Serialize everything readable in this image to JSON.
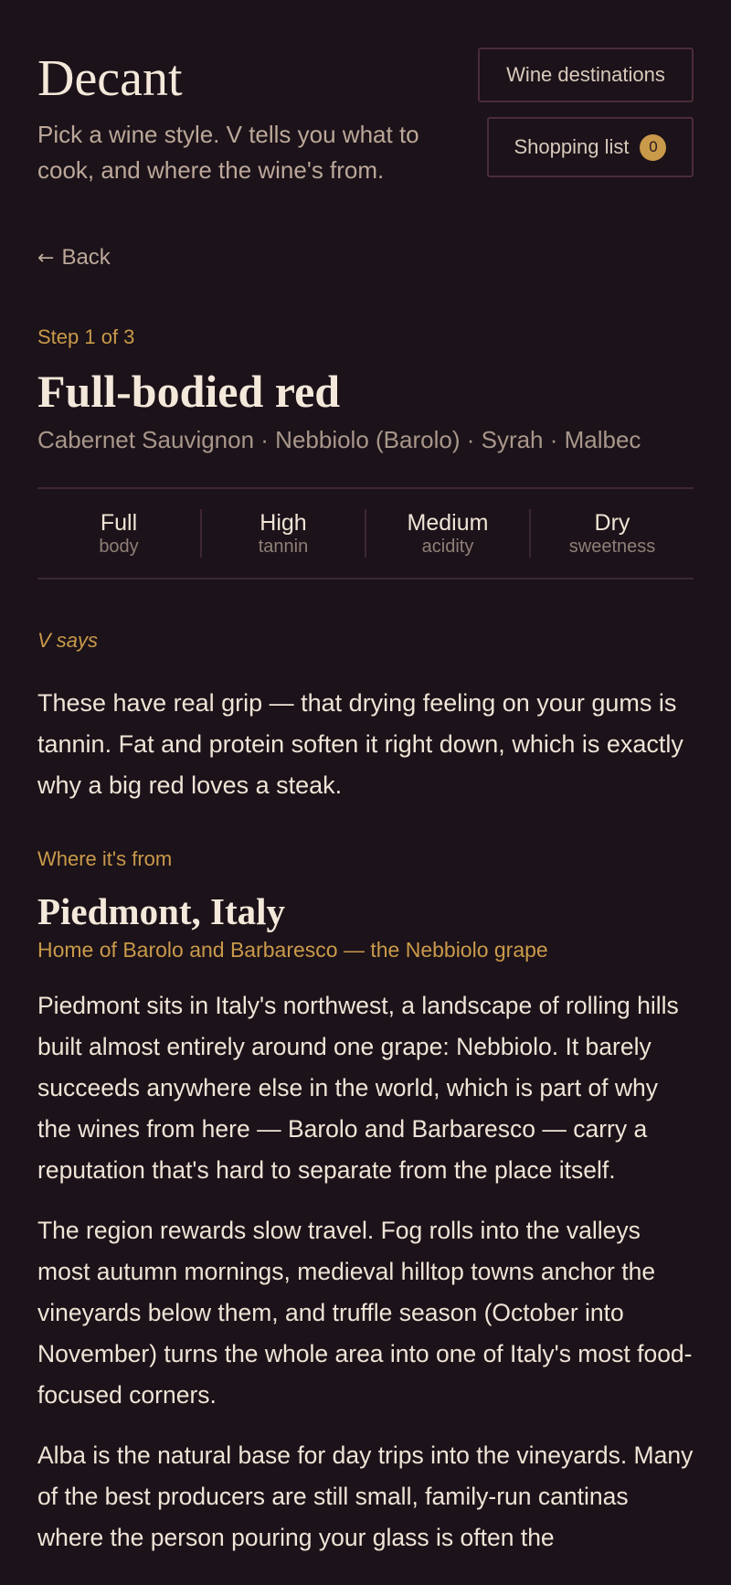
{
  "header": {
    "title": "Decant",
    "tagline": "Pick a wine style. V tells you what to cook, and where the wine's from.",
    "destinations_label": "Wine destinations",
    "shopping_label": "Shopping list",
    "shopping_count": "0"
  },
  "nav": {
    "back_label": "Back",
    "back_icon": "left-arrow-icon"
  },
  "step": {
    "label": "Step 1 of 3",
    "title": "Full-bodied red",
    "grapes": "Cabernet Sauvignon · Nebbiolo (Barolo) · Syrah · Malbec"
  },
  "attributes": [
    {
      "value": "Full",
      "label": "body"
    },
    {
      "value": "High",
      "label": "tannin"
    },
    {
      "value": "Medium",
      "label": "acidity"
    },
    {
      "value": "Dry",
      "label": "sweetness"
    }
  ],
  "v_says": {
    "label": "V says",
    "text": "These have real grip — that drying feeling on your gums is tannin. Fat and protein soften it right down, which is exactly why a big red loves a steak."
  },
  "origin": {
    "label": "Where it's from",
    "region": "Piedmont, Italy",
    "subtitle": "Home of Barolo and Barbaresco — the Nebbiolo grape",
    "paragraphs": [
      "Piedmont sits in Italy's northwest, a landscape of rolling hills built almost entirely around one grape: Nebbiolo. It barely succeeds anywhere else in the world, which is part of why the wines from here — Barolo and Barbaresco — carry a reputation that's hard to separate from the place itself.",
      "The region rewards slow travel. Fog rolls into the valleys most autumn mornings, medieval hilltop towns anchor the vineyards below them, and truffle season (October into November) turns the whole area into one of Italy's most food-focused corners.",
      "Alba is the natural base for day trips into the vineyards. Many of the best producers are still small, family-run cantinas where the person pouring your glass is often the"
    ]
  },
  "colors": {
    "background": "#1c1219",
    "accent": "#c99a4a",
    "border": "#4a2c3a",
    "text": "#efe4d6",
    "muted": "#bba899"
  }
}
